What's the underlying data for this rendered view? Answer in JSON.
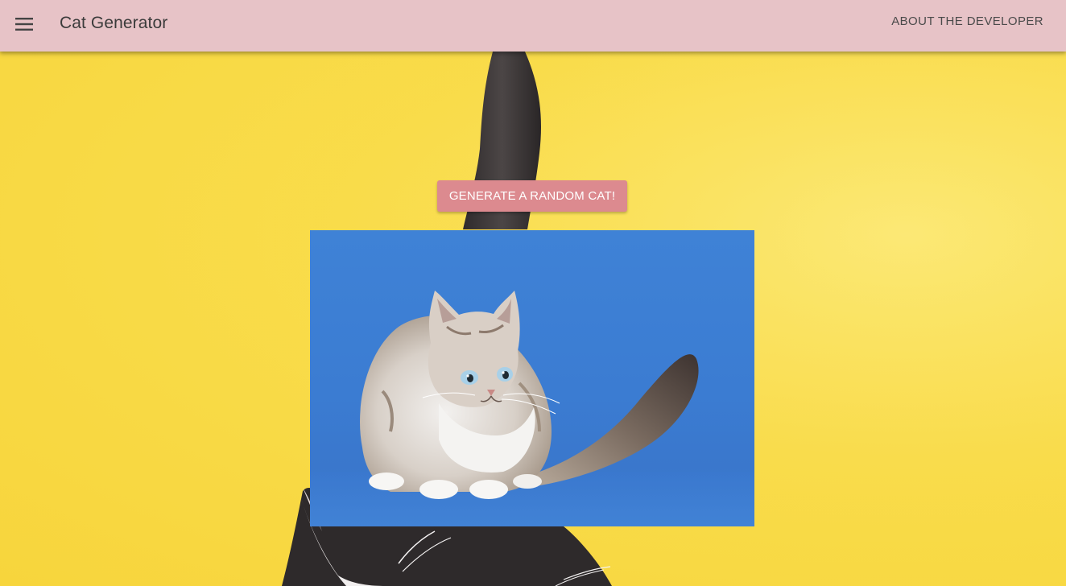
{
  "app": {
    "title": "Cat Generator",
    "menu_icon": "menu-icon",
    "about_label": "ABOUT THE DEVELOPER"
  },
  "main": {
    "generate_label": "GENERATE A RANDOM CAT!",
    "photo_alt": "cat-photo"
  },
  "colors": {
    "appbar": "#e7c3c7",
    "button": "#dc8a8f",
    "background": "#f9dc4a",
    "photo_bg": "#3d7ed4"
  }
}
